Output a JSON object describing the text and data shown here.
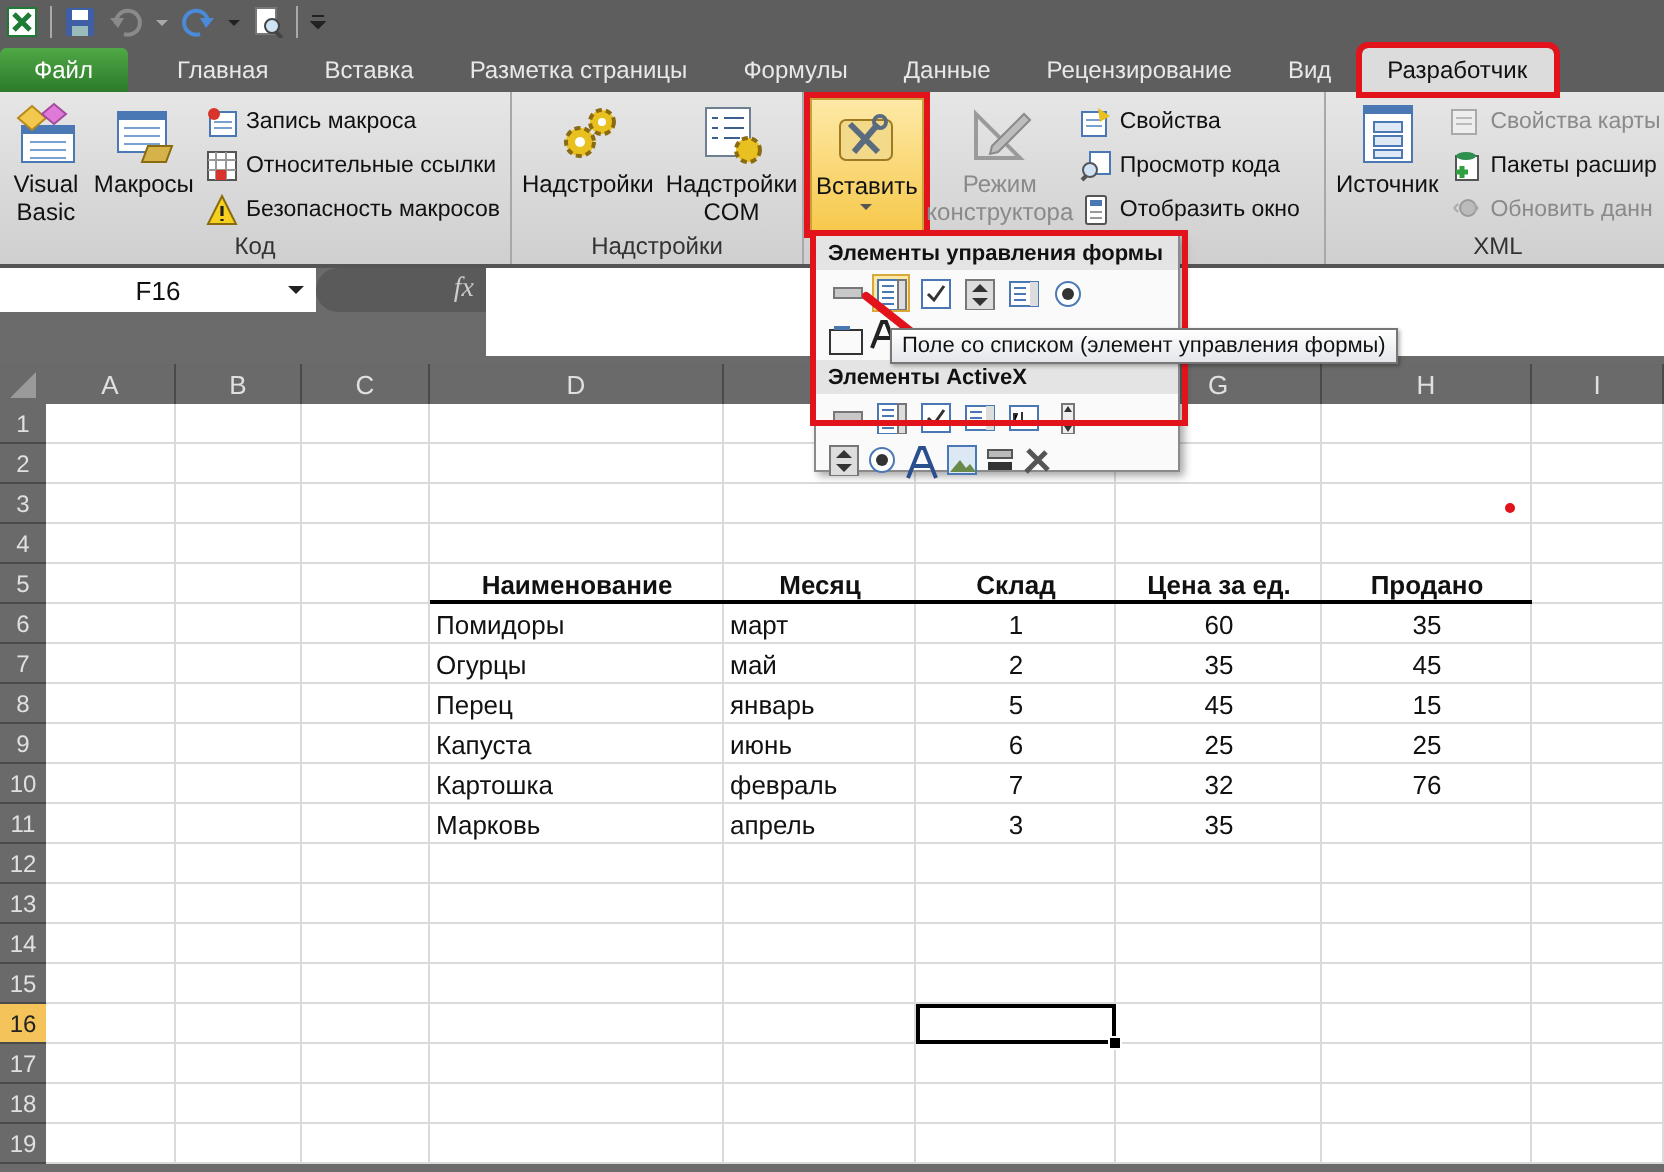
{
  "tabs": [
    {
      "label": "Файл",
      "kind": "file",
      "selected": false,
      "annotated": false
    },
    {
      "label": "Главная",
      "kind": "normal",
      "selected": false,
      "annotated": false
    },
    {
      "label": "Вставка",
      "kind": "normal",
      "selected": false,
      "annotated": false
    },
    {
      "label": "Разметка страницы",
      "kind": "normal",
      "selected": false,
      "annotated": false
    },
    {
      "label": "Формулы",
      "kind": "normal",
      "selected": false,
      "annotated": false
    },
    {
      "label": "Данные",
      "kind": "normal",
      "selected": false,
      "annotated": false
    },
    {
      "label": "Рецензирование",
      "kind": "normal",
      "selected": false,
      "annotated": false
    },
    {
      "label": "Вид",
      "kind": "normal",
      "selected": false,
      "annotated": false
    },
    {
      "label": "Разработчик",
      "kind": "normal",
      "selected": true,
      "annotated": true
    }
  ],
  "ribbon": {
    "groups": [
      {
        "label": "Код",
        "large": [
          {
            "label": "Visual Basic",
            "selected": false,
            "disabled": false,
            "annotated": false
          },
          {
            "label": "Макросы",
            "selected": false,
            "disabled": false,
            "annotated": false
          }
        ],
        "small": [
          {
            "label": "Запись макроса",
            "disabled": false
          },
          {
            "label": "Относительные ссылки",
            "disabled": false
          },
          {
            "label": "Безопасность макросов",
            "disabled": false
          }
        ]
      },
      {
        "label": "Надстройки",
        "large": [
          {
            "label": "Надстройки",
            "selected": false,
            "disabled": false,
            "annotated": false
          },
          {
            "label": "Надстройки COM",
            "selected": false,
            "disabled": false,
            "annotated": false
          }
        ]
      },
      {
        "large": [
          {
            "label": "Вставить",
            "selected": true,
            "disabled": false,
            "annotated": true
          },
          {
            "label": "Режим конструктора",
            "selected": false,
            "disabled": true,
            "annotated": false
          }
        ],
        "small": [
          {
            "label": "Свойства",
            "disabled": false
          },
          {
            "label": "Просмотр кода",
            "disabled": false
          },
          {
            "label": "Отобразить окно",
            "disabled": false
          }
        ]
      },
      {
        "label": "XML",
        "large": [
          {
            "label": "Источник",
            "selected": false,
            "disabled": false,
            "annotated": false
          }
        ],
        "small": [
          {
            "label": "Свойства карты",
            "disabled": true
          },
          {
            "label": "Пакеты расшир",
            "disabled": false
          },
          {
            "label": "Обновить данн",
            "disabled": true
          }
        ]
      }
    ]
  },
  "formula_bar": {
    "name_box": "F16",
    "function_label": "fx"
  },
  "sheet": {
    "columns_before_menu": [
      "A",
      "B",
      "C",
      "D"
    ],
    "columns_after_menu": [
      "G",
      "H",
      "I"
    ],
    "rows": [
      {
        "label": "1",
        "selected": false
      },
      {
        "label": "2",
        "selected": false
      },
      {
        "label": "3",
        "selected": false
      },
      {
        "label": "4",
        "selected": false
      },
      {
        "label": "5",
        "selected": false
      },
      {
        "label": "6",
        "selected": false
      },
      {
        "label": "7",
        "selected": false
      },
      {
        "label": "8",
        "selected": false
      },
      {
        "label": "9",
        "selected": false
      },
      {
        "label": "10",
        "selected": false
      },
      {
        "label": "11",
        "selected": false
      },
      {
        "label": "12",
        "selected": false
      },
      {
        "label": "13",
        "selected": false
      },
      {
        "label": "14",
        "selected": false
      },
      {
        "label": "15",
        "selected": false
      },
      {
        "label": "16",
        "selected": true
      },
      {
        "label": "17",
        "selected": false
      },
      {
        "label": "18",
        "selected": false
      },
      {
        "label": "19",
        "selected": false
      }
    ],
    "table": {
      "headers": [
        "Наименование",
        "Месяц",
        "Склад",
        "Цена за ед.",
        "Продано"
      ],
      "rows": [
        {
          "name": "Помидоры",
          "month": "март",
          "stock": "1",
          "price": "60",
          "sold": "35"
        },
        {
          "name": "Огурцы",
          "month": "май",
          "stock": "2",
          "price": "35",
          "sold": "45"
        },
        {
          "name": "Перец",
          "month": "январь",
          "stock": "5",
          "price": "45",
          "sold": "15"
        },
        {
          "name": "Капуста",
          "month": "июнь",
          "stock": "6",
          "price": "25",
          "sold": "25"
        },
        {
          "name": "Картошка",
          "month": "февраль",
          "stock": "7",
          "price": "32",
          "sold": "76"
        },
        {
          "name": "Марковь",
          "month": "апрель",
          "stock": "3",
          "price": "35"
        }
      ]
    }
  },
  "insert_menu": {
    "sections": [
      {
        "title": "Элементы управления формы",
        "controls": [
          {
            "hovered": false
          },
          {
            "hovered": true
          },
          {
            "hovered": false
          },
          {
            "hovered": false
          },
          {
            "hovered": false
          },
          {
            "hovered": false
          }
        ]
      },
      {
        "title": "Элементы ActiveX",
        "controls": [
          {
            "hovered": false
          },
          {
            "hovered": false
          },
          {
            "hovered": false
          },
          {
            "hovered": false
          },
          {
            "hovered": false
          },
          {
            "hovered": false
          }
        ]
      }
    ]
  },
  "tooltip": {
    "text": "Поле со списком (элемент управления формы)"
  }
}
